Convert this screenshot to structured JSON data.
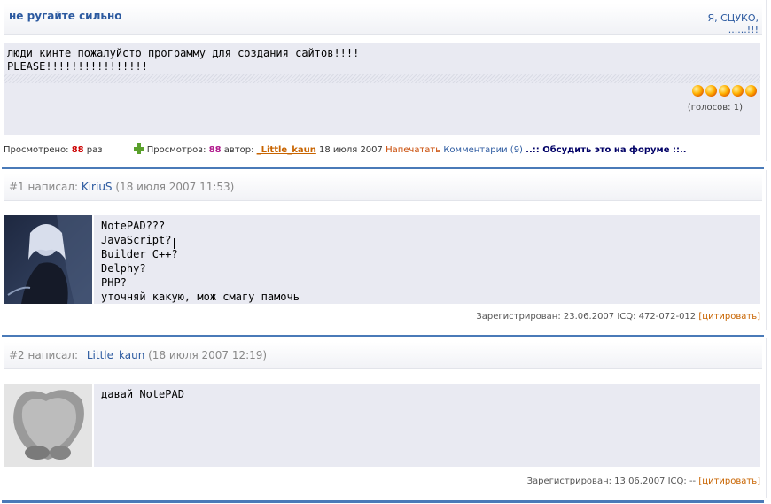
{
  "article": {
    "title": "не ругайте сильно",
    "right_line1": "Я, СЦУКО,",
    "right_line2": "......!!!",
    "message_line1": "люди кинте пожалуйсто программу для создания сайтов!!!!",
    "message_line2": "PLEASE!!!!!!!!!!!!!!!!",
    "votes": "(голосов: 1)",
    "rating_stars": 5
  },
  "infobar": {
    "viewed_label": "Просмотрено:",
    "viewed_count": "88",
    "viewed_unit": "раз",
    "views_label": "Просмотров:",
    "views_count": "88",
    "author_label": "автор:",
    "author": "_Little_kaun",
    "date": "18 июля 2007",
    "print": "Напечатать",
    "comments": "Комментарии (9)",
    "forum": "..:: Обсудить это на форуме ::.."
  },
  "comments": [
    {
      "num": "#1 написал:",
      "nick": "KiriuS",
      "time": "(18 июля 2007 11:53)",
      "lines": [
        "NotePAD???",
        "JavaScript?",
        "Builder C++?",
        "Delphy?",
        "PHP?",
        "уточняй какую, мож смагу памочь"
      ],
      "footer": "Зарегистрирован: 23.06.2007 ICQ: 472-072-012",
      "cite": "[цитировать]"
    },
    {
      "num": "#2 написал:",
      "nick": "_Little_kaun",
      "time": "(18 июля 2007 12:19)",
      "lines": [
        "давай NotePAD"
      ],
      "footer": "Зарегистрирован: 13.06.2007 ICQ: --",
      "cite": "[цитировать]"
    }
  ],
  "colors": {
    "accent": "#2c5aa0",
    "separator": "#4a7ab8",
    "panel": "#e9eaf2",
    "author": "#c86400"
  }
}
